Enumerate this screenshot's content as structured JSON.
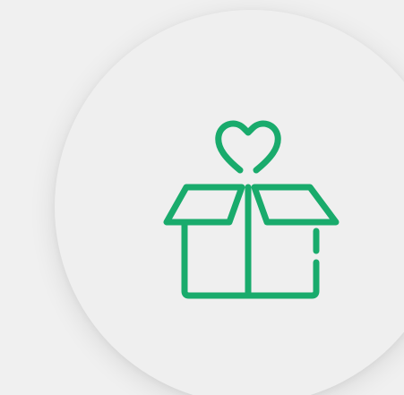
{
  "icon": {
    "name": "donation-box-heart-icon",
    "color": "#19ab6c"
  },
  "colors": {
    "background": "#f0f0f0",
    "circle": "#efefef",
    "accent": "#19ab6c"
  }
}
